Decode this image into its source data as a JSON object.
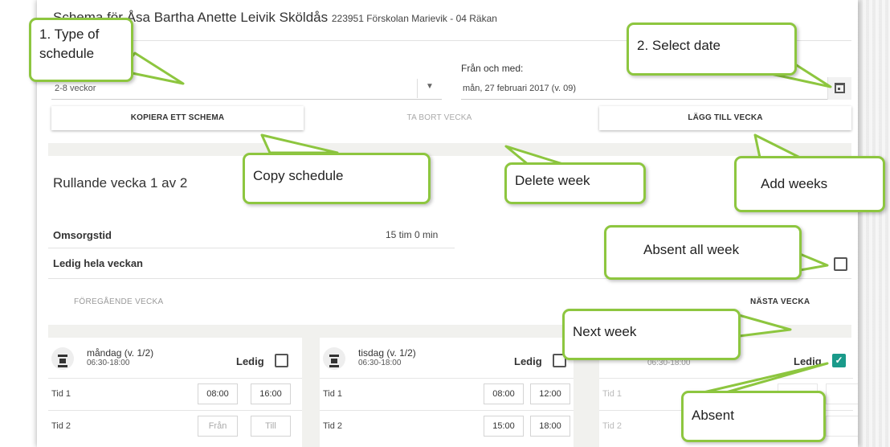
{
  "header": {
    "title_prefix": "Schema för Åsa",
    "child_name": "Bartha Anette Leivik Sköldås",
    "subtitle": "223951 Förskolan Marievik - 04 Räkan"
  },
  "form": {
    "schedule_type_value": "2-8 veckor",
    "from_label": "Från och med:",
    "date_value": "mån, 27 februari 2017 (v. 09)"
  },
  "actions": {
    "copy": "KOPIERA ETT SCHEMA",
    "delete": "TA BORT VECKA",
    "add": "LÄGG TILL VECKA"
  },
  "week": {
    "title": "Rullande vecka 1 av 2",
    "care_label": "Omsorgstid",
    "care_value": "15 tim 0 min",
    "absent_label": "Ledig hela veckan",
    "absent_all_checked": false,
    "prev": "FÖREGÅENDE VECKA",
    "next": "NÄSTA VECKA"
  },
  "days": [
    {
      "name": "måndag (v. 1/2)",
      "range": "06:30-18:00",
      "ledig": "Ledig",
      "checked": false,
      "tid1_label": "Tid 1",
      "tid1_from": "08:00",
      "tid1_to": "16:00",
      "tid2_label": "Tid 2",
      "tid2_from": "Från",
      "tid2_to": "Till"
    },
    {
      "name": "tisdag (v. 1/2)",
      "range": "06:30-18:00",
      "ledig": "Ledig",
      "checked": false,
      "tid1_label": "Tid 1",
      "tid1_from": "08:00",
      "tid1_to": "12:00",
      "tid2_label": "Tid 2",
      "tid2_from": "15:00",
      "tid2_to": "18:00"
    },
    {
      "name": "",
      "range": "06:30-18:00",
      "ledig": "Ledig",
      "checked": true,
      "tid1_label": "Tid 1",
      "tid2_label": "Tid 2"
    }
  ],
  "callouts": {
    "type_of_schedule": "1. Type of schedule",
    "select_date": "2. Select date",
    "copy_schedule": "Copy schedule",
    "delete_week": "Delete week",
    "add_weeks": "Add weeks",
    "absent_all_week": "Absent all week",
    "next_week": "Next week",
    "absent": "Absent"
  },
  "colors": {
    "callout_border": "#8dc63f",
    "check_accent": "#1a9a8a"
  },
  "icons": [
    "calendar-icon",
    "chevron-down-icon",
    "checkbox-icon",
    "schedule-day-icon"
  ]
}
